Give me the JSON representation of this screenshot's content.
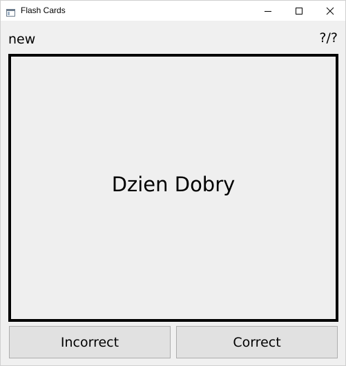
{
  "window": {
    "title": "Flash Cards"
  },
  "icons": {
    "app": "app-window-icon",
    "minimize": "minimize-icon",
    "maximize": "maximize-icon",
    "close": "close-icon"
  },
  "header": {
    "status": "new",
    "counter": "?/?"
  },
  "card": {
    "text": "Dzien Dobry"
  },
  "actions": {
    "incorrect_label": "Incorrect",
    "correct_label": "Correct"
  }
}
